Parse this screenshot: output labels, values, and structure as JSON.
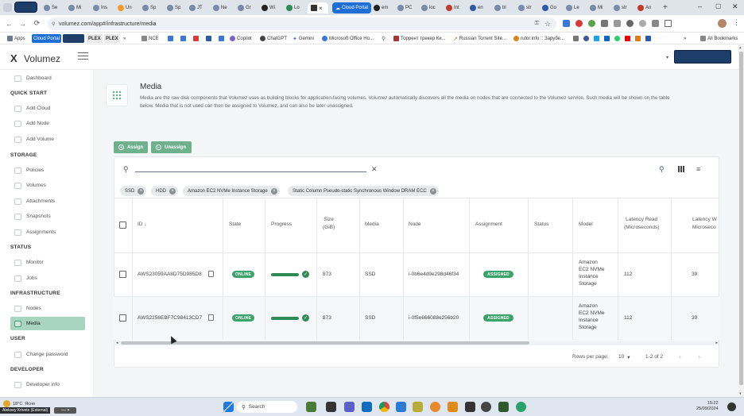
{
  "browser": {
    "tabs": [
      "Se",
      "Mi",
      "Ins",
      "Un",
      "Sp",
      "Sp",
      "JT",
      "Ne",
      "Gr",
      "Wi",
      "Lo",
      "Cloud Portal",
      "em",
      "PC",
      "loc",
      "Int",
      "en",
      "bl",
      "str",
      "Go",
      "Le",
      "Mi",
      "str",
      "An"
    ],
    "active_tab_close": "×",
    "new_tab": "+",
    "url": "volumez.com/app#/infrastructure/media",
    "bookmarks": [
      "Apps",
      "Cloud Portal",
      "PLEX",
      "PLEX",
      "NCE",
      "Copilot",
      "ChatGPT",
      "Gemini",
      "Microsoft Office Ho...",
      "Торрент трекер Ки...",
      "Russian Torrent Site...",
      "rutor.info :: Зарубе..."
    ],
    "all_bookmarks": "All Bookmarks",
    "more": "»"
  },
  "app": {
    "logo": "Volumez"
  },
  "sidebar": {
    "dashboard": "Dashboard",
    "sections": [
      {
        "title": "QUICK START",
        "items": [
          "Add Cloud",
          "Add Node",
          "Add Volume"
        ]
      },
      {
        "title": "STORAGE",
        "items": [
          "Policies",
          "Volumes",
          "Attachments",
          "Snapshots",
          "Assignments"
        ]
      },
      {
        "title": "STATUS",
        "items": [
          "Monitor",
          "Jobs"
        ]
      },
      {
        "title": "INFRASTRUCTURE",
        "items": [
          "Nodes",
          "Media"
        ]
      },
      {
        "title": "USER",
        "items": [
          "Change password"
        ]
      },
      {
        "title": "DEVELOPER",
        "items": [
          "Developer info"
        ]
      }
    ],
    "active": "Media"
  },
  "page": {
    "title": "Media",
    "description_line1": "Media are the raw disk components that Volumez uses as building blocks for application-facing volumes. Volumez automatically discovers all the media on nodes that are connected to the Volumez service. Such media will be shown on the table",
    "description_line2": "below. Media that is not used can then be assigned to Volumez, and can also be later unassigned.",
    "assign_label": "Assign",
    "unassign_label": "Unassign"
  },
  "filters": [
    "SSD",
    "HDD",
    "Amazon EC2 NVMe Instance Storage",
    "Static Column Pseudo-static Synchronous Window DRAM ECC"
  ],
  "table": {
    "headers": {
      "id": "ID",
      "sort_icon": "↓",
      "state": "State",
      "progress": "Progress",
      "size": "Size",
      "size_unit": "(GiB)",
      "media": "Media",
      "node": "Node",
      "assignment": "Assignment",
      "status": "Status",
      "model": "Model",
      "latency_read": "Latency Read",
      "latency_read_unit": "(Microseconds)",
      "latency_write": "Latency W",
      "latency_write_unit": "Microseco"
    },
    "rows": [
      {
        "id": "AWS23059AA8D75D985D8",
        "state": "ONLINE",
        "progress": 1.0,
        "size": "873",
        "media": "SSD",
        "node": "i-0b6e4d9e298d46f34",
        "assignment": "ASSIGNED",
        "status": "",
        "model": [
          "Amazon",
          "EC2 NVMe",
          "Instance",
          "Storage"
        ],
        "latency_read": "112",
        "latency_write": "39"
      },
      {
        "id": "AWS2256EBF7C98413CD7",
        "state": "ONLINE",
        "progress": 1.0,
        "size": "873",
        "media": "SSD",
        "node": "i-0f5e666088e256b20",
        "assignment": "ASSIGNED",
        "status": "",
        "model": [
          "Amazon",
          "EC2 NVMe",
          "Instance",
          "Storage"
        ],
        "latency_read": "112",
        "latency_write": "39"
      }
    ]
  },
  "pagination": {
    "rows_per_page_label": "Rows per page:",
    "rows_per_page": "10",
    "range": "1-2 of 2"
  },
  "taskbar": {
    "search": "Search",
    "time": "15:22",
    "date": "25/09/2024",
    "weather_temp": "18°C",
    "weather_text": "Ясно",
    "tray_user": "Aleksey Krivets (External)"
  }
}
